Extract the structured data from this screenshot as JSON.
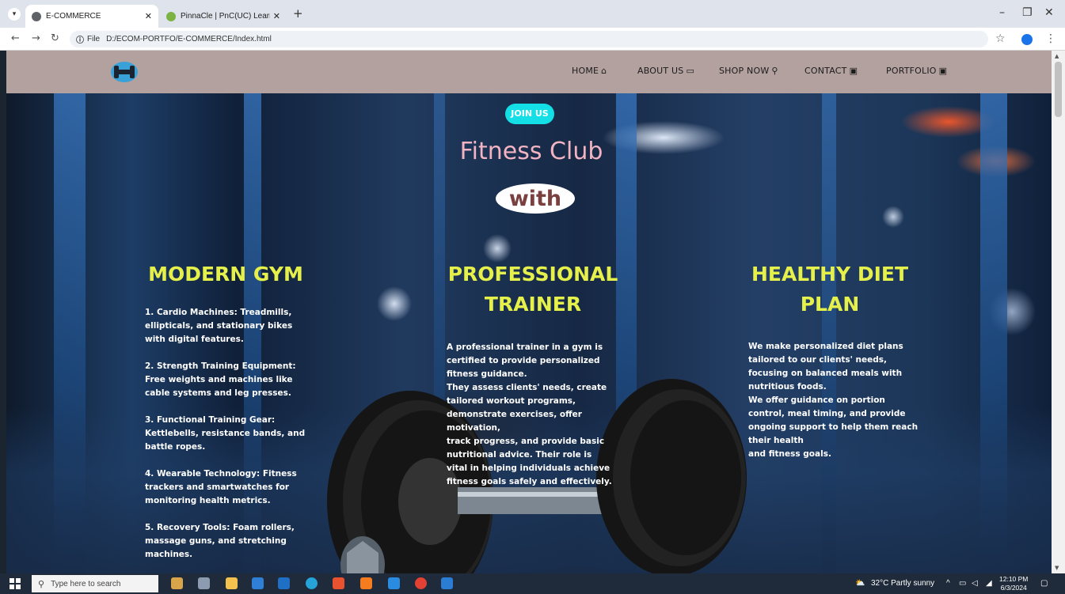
{
  "browser": {
    "tabs": [
      {
        "title": "E-COMMERCE",
        "active": true
      },
      {
        "title": "PinnaCle | PnC(UC) Learning Ma",
        "active": false
      }
    ],
    "url_prefix": "File",
    "url": "D:/ECOM-PORTFO/E-COMMERCE/Index.html"
  },
  "site": {
    "nav": [
      {
        "label": "HOME",
        "icon": "home-icon"
      },
      {
        "label": "ABOUT US",
        "icon": "id-card-icon"
      },
      {
        "label": "SHOP NOW",
        "icon": "search-icon"
      },
      {
        "label": "CONTACT",
        "icon": "contact-card-icon"
      },
      {
        "label": "PORTFOLIO",
        "icon": "portfolio-icon"
      }
    ],
    "join_label": "JOIN US",
    "hero_title": "Fitness Club",
    "hero_sub": "with",
    "columns": [
      {
        "heading": "MODERN GYM",
        "items": [
          "1. Cardio Machines: Treadmills, ellipticals, and stationary bikes with digital features.",
          "2. Strength Training Equipment: Free weights and machines like cable systems and leg presses.",
          "3. Functional Training Gear: Kettlebells, resistance bands, and battle ropes.",
          "4. Wearable Technology: Fitness trackers and smartwatches for monitoring health metrics.",
          "5. Recovery Tools: Foam rollers, massage guns, and stretching machines."
        ]
      },
      {
        "heading": "PROFESSIONAL TRAINER",
        "lines": [
          "A professional trainer in a gym is certified to provide personalized fitness guidance.",
          "They assess clients' needs, create tailored workout programs, demonstrate exercises, offer motivation,",
          "track progress, and provide basic nutritional advice. Their role is vital in helping individuals achieve fitness goals safely and effectively."
        ]
      },
      {
        "heading": "HEALTHY DIET PLAN",
        "lines": [
          "We make personalized diet plans tailored to our clients' needs, focusing on balanced meals with nutritious foods.",
          "We offer guidance on portion control, meal timing, and provide ongoing support to help them reach their health",
          "and fitness goals."
        ]
      }
    ]
  },
  "taskbar": {
    "search_placeholder": "Type here to search",
    "weather": "32°C  Partly sunny",
    "time": "12:10 PM",
    "date": "6/3/2024"
  },
  "colors": {
    "nav_bg": "#b3a19f",
    "join_bg": "#14dfe6",
    "heading": "#e6f04a",
    "hero_title": "#f2b3c2",
    "hero_sub": "#7a3f3f"
  }
}
